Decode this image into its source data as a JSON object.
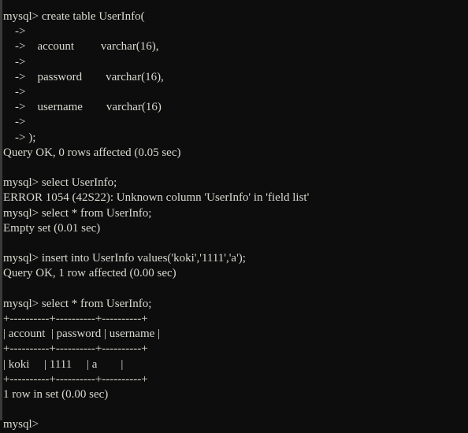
{
  "terminal": {
    "app": "mysql-client-console",
    "prompt": "mysql>",
    "continuation_prompt": "->",
    "colors": {
      "background": "#0d0d0d",
      "foreground": "#d9d9d1",
      "left_edge": "#3a3a3a"
    },
    "lines": [
      "mysql> create table UserInfo(",
      "    ->",
      "    ->    account         varchar(16),",
      "    ->",
      "    ->    password        varchar(16),",
      "    ->",
      "    ->    username        varchar(16)",
      "    ->",
      "    -> );",
      "Query OK, 0 rows affected (0.05 sec)",
      "",
      "mysql> select UserInfo;",
      "ERROR 1054 (42S22): Unknown column 'UserInfo' in 'field list'",
      "mysql> select * from UserInfo;",
      "Empty set (0.01 sec)",
      "",
      "mysql> insert into UserInfo values('koki','1111','a');",
      "Query OK, 1 row affected (0.00 sec)",
      "",
      "mysql> select * from UserInfo;",
      "+----------+----------+----------+",
      "| account  | password | username |",
      "+----------+----------+----------+",
      "| koki     | 1111     | a        |",
      "+----------+----------+----------+",
      "1 row in set (0.00 sec)",
      "",
      "mysql>"
    ],
    "statements": [
      {
        "command": "create table UserInfo(\n    ->\n    ->    account         varchar(16),\n    ->\n    ->    password        varchar(16),\n    ->\n    ->    username        varchar(16)\n    ->\n    -> );",
        "result": "Query OK, 0 rows affected (0.05 sec)"
      },
      {
        "command": "select UserInfo;",
        "result": "ERROR 1054 (42S22): Unknown column 'UserInfo' in 'field list'"
      },
      {
        "command": "select * from UserInfo;",
        "result": "Empty set (0.01 sec)"
      },
      {
        "command": "insert into UserInfo values('koki','1111','a');",
        "result": "Query OK, 1 row affected (0.00 sec)"
      },
      {
        "command": "select * from UserInfo;",
        "result": "1 row in set (0.00 sec)"
      }
    ],
    "created_table": {
      "name": "UserInfo",
      "columns": [
        {
          "name": "account",
          "type": "varchar(16)"
        },
        {
          "name": "password",
          "type": "varchar(16)"
        },
        {
          "name": "username",
          "type": "varchar(16)"
        }
      ]
    },
    "result_table": {
      "headers": [
        "account",
        "password",
        "username"
      ],
      "rows": [
        [
          "koki",
          "1111",
          "a"
        ]
      ],
      "row_count_text": "1 row in set (0.00 sec)"
    },
    "error": {
      "code": "ERROR 1054",
      "sqlstate": "42S22",
      "message": "Unknown column 'UserInfo' in 'field list'"
    }
  }
}
